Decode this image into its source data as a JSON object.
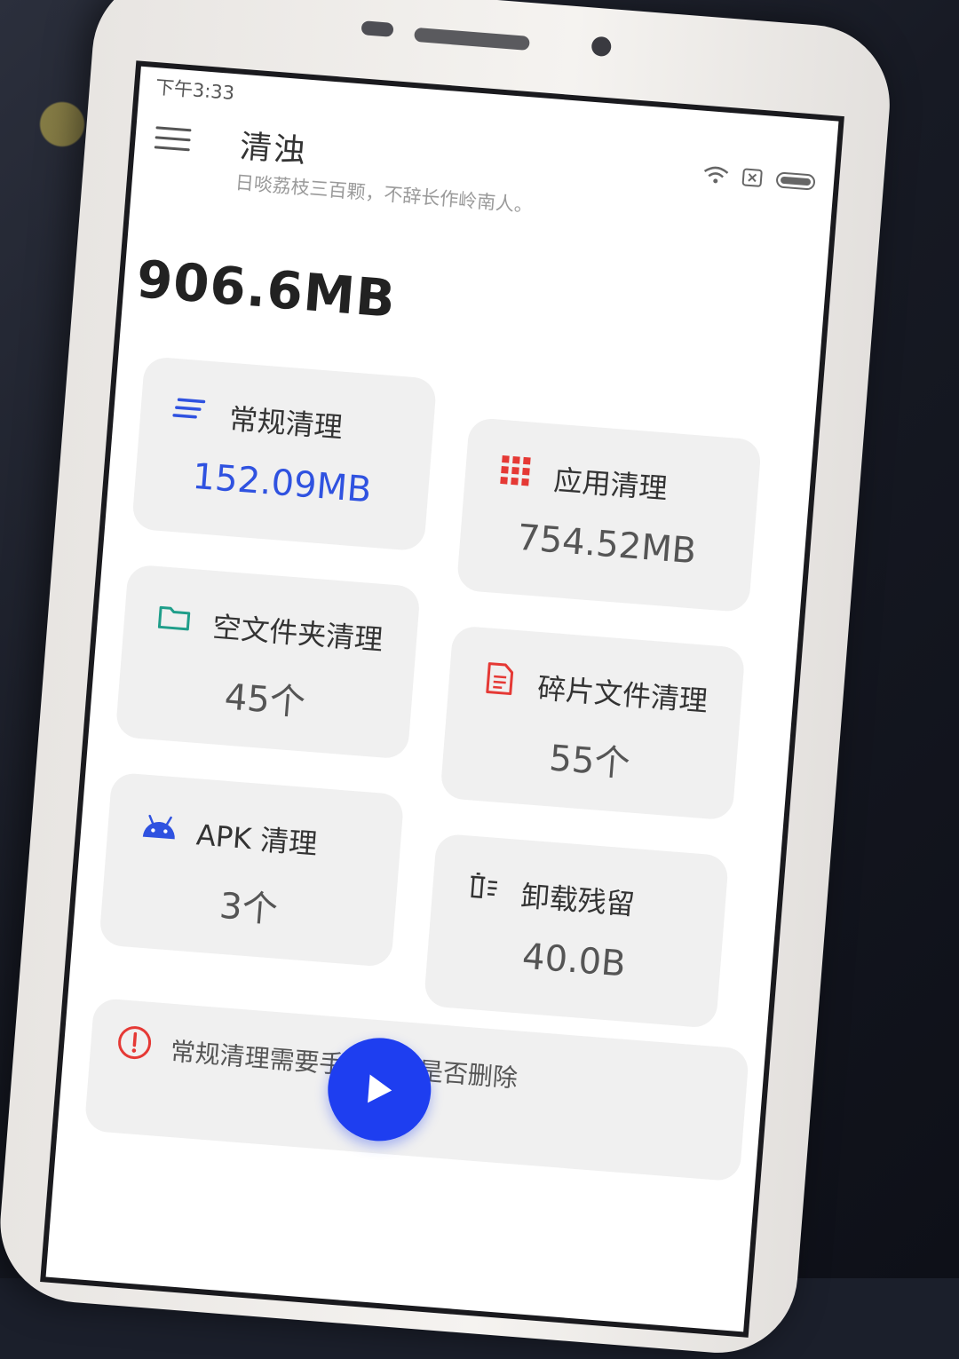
{
  "status_bar": {
    "time": "下午3:33"
  },
  "header": {
    "title": "清浊",
    "subtitle": "日啖荔枝三百颗，不辞长作岭南人。"
  },
  "summary": {
    "total": "906.6MB"
  },
  "cards": [
    {
      "label": "常规清理",
      "value": "152.09MB",
      "icon": "lines-icon",
      "icon_color": "#2f52e0"
    },
    {
      "label": "应用清理",
      "value": "754.52MB",
      "icon": "grid-icon",
      "icon_color": "#e53935"
    },
    {
      "label": "空文件夹清理",
      "value": "45个",
      "icon": "folder-icon",
      "icon_color": "#1f9e8a"
    },
    {
      "label": "碎片文件清理",
      "value": "55个",
      "icon": "document-icon",
      "icon_color": "#e53935"
    },
    {
      "label": "APK 清理",
      "value": "3个",
      "icon": "android-icon",
      "icon_color": "#2f52e0"
    },
    {
      "label": "卸载残留",
      "value": "40.0B",
      "icon": "trash-list-icon",
      "icon_color": "#333333"
    }
  ],
  "notice": {
    "text": "常规清理需要手动确认是否删除",
    "icon": "alert-icon",
    "icon_color": "#e53935"
  },
  "action": {
    "icon": "play-icon",
    "color": "#1e3ef0"
  }
}
